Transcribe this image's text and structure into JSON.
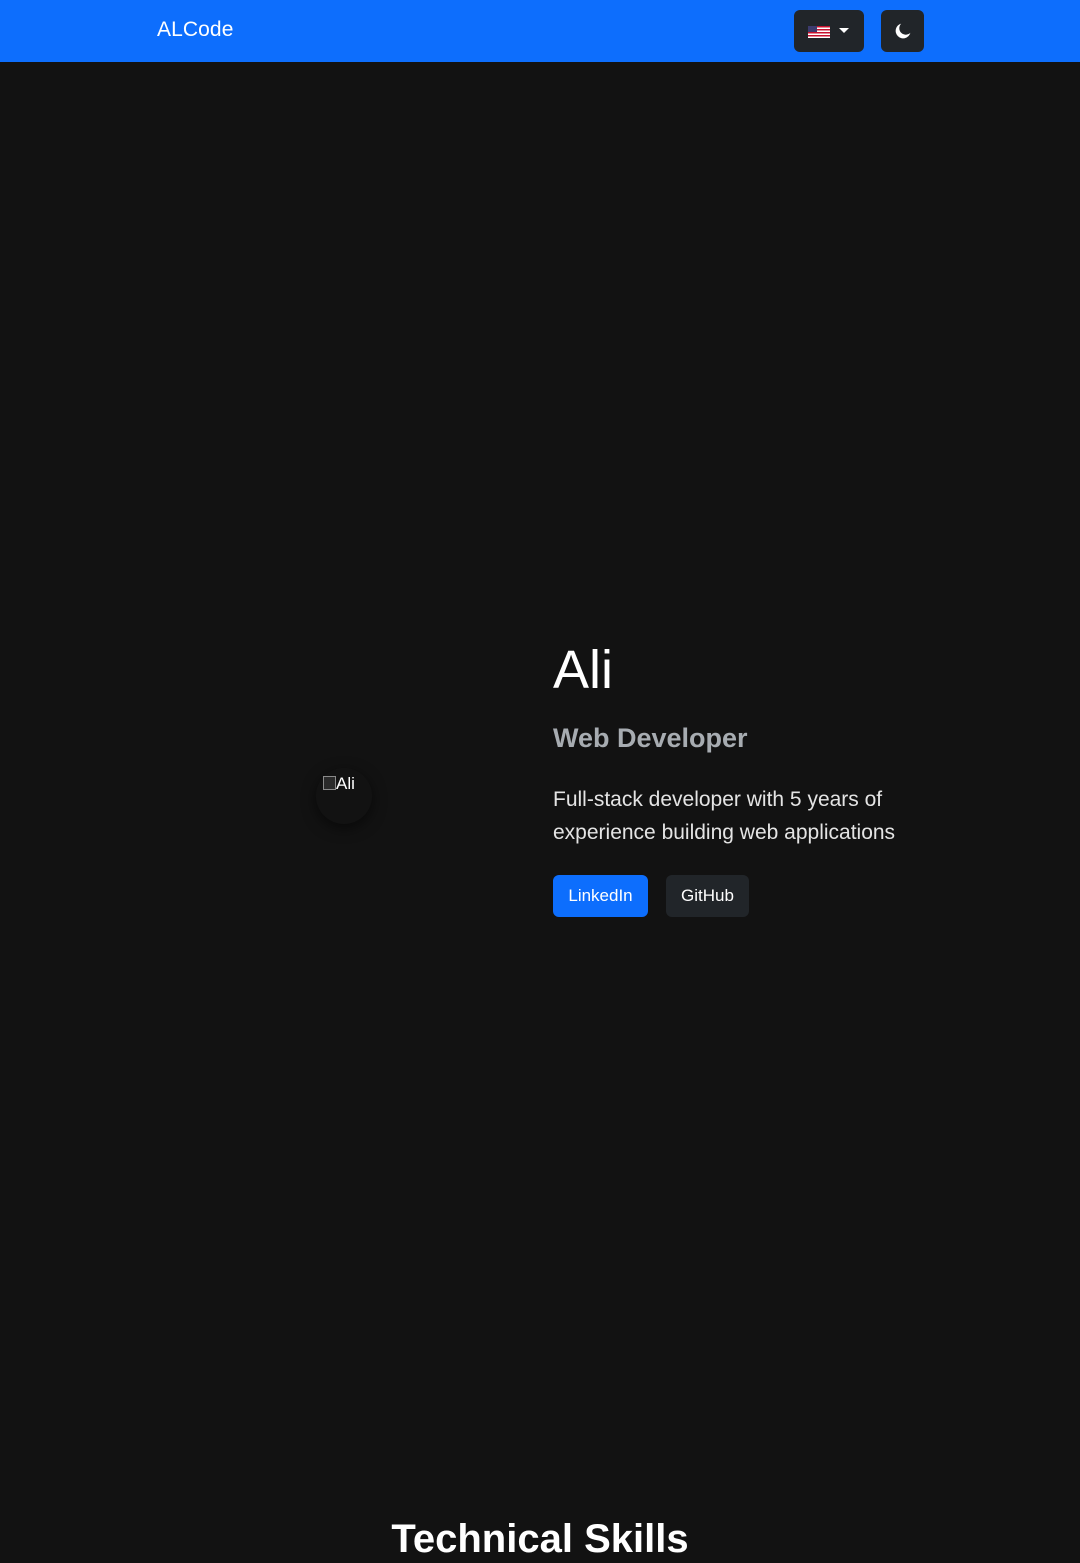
{
  "navbar": {
    "brand": "ALCode",
    "language": {
      "selected_icon": "us-flag-icon"
    },
    "theme_toggle": {
      "icon": "moon-icon"
    }
  },
  "colors": {
    "navbar_bg": "#0d6efd",
    "page_bg": "#121212",
    "dark_button_bg": "#212529",
    "primary_button_bg": "#0d6efd",
    "subtitle_text": "#a7acb1"
  },
  "hero": {
    "avatar_alt": "Ali",
    "name": "Ali",
    "title": "Web Developer",
    "description": "Full-stack developer with 5 years of experience building web applications",
    "buttons": {
      "linkedin": "LinkedIn",
      "github": "GitHub"
    }
  },
  "skills_section": {
    "heading": "Technical Skills"
  }
}
